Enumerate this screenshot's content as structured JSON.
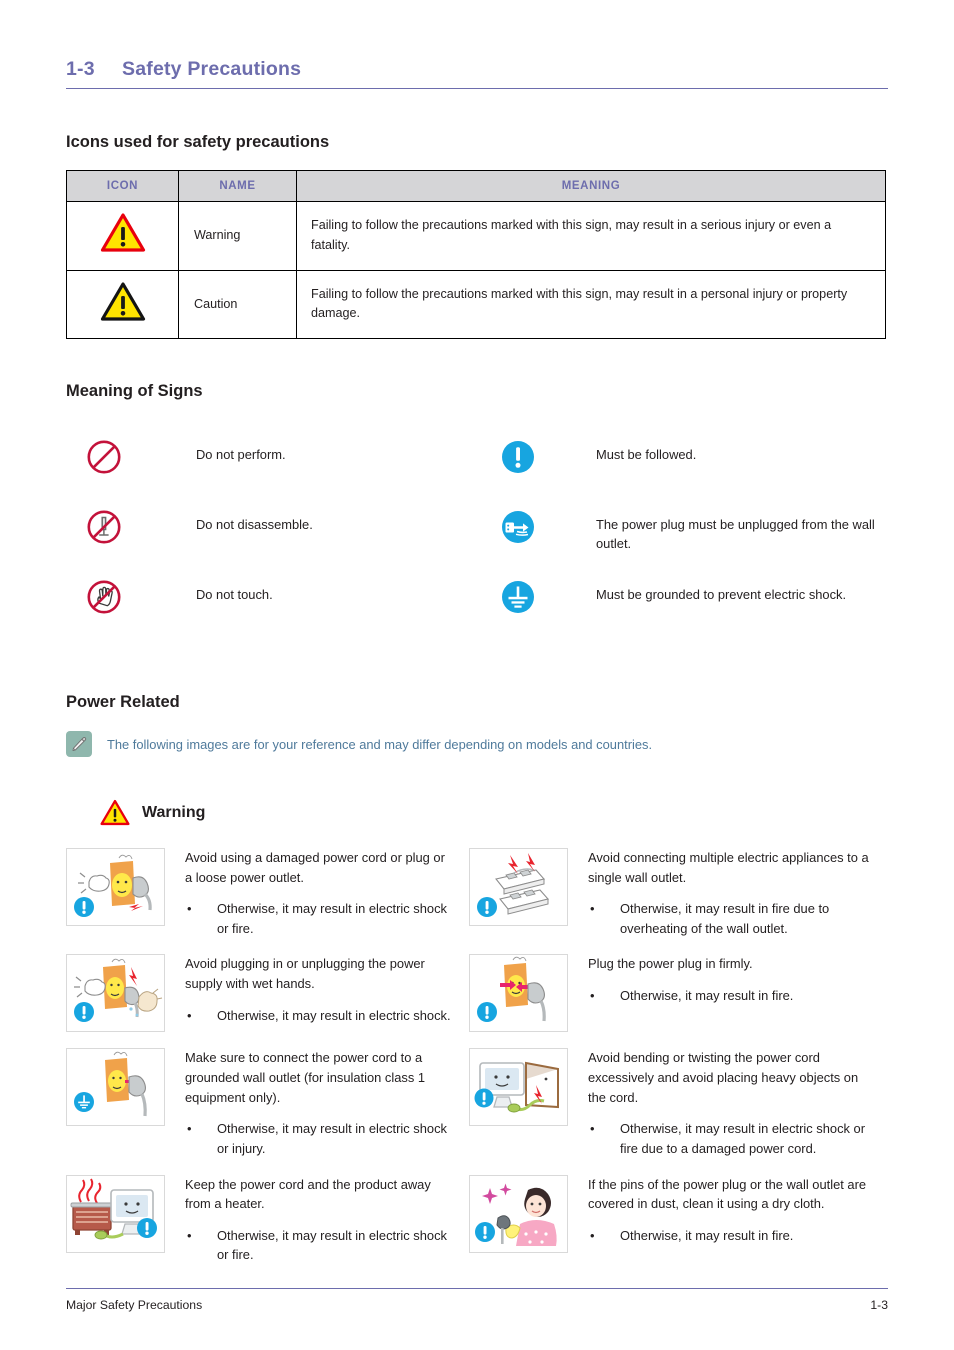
{
  "header": {
    "chapter_number": "1-3",
    "chapter_title": "Safety Precautions"
  },
  "sections": {
    "icons_heading": "Icons used for safety precautions",
    "signs_heading": "Meaning of Signs",
    "power_heading": "Power Related"
  },
  "icons_table": {
    "columns": [
      "ICON",
      "NAME",
      "MEANING"
    ],
    "rows": [
      {
        "icon": "warning-triangle-red-icon",
        "name": "Warning",
        "meaning": "Failing to follow the precautions marked with this sign, may result in a serious injury or even a fatality."
      },
      {
        "icon": "caution-triangle-black-icon",
        "name": "Caution",
        "meaning": "Failing to follow the precautions marked with this sign, may result in a personal injury or property damage."
      }
    ]
  },
  "meaning_of_signs": {
    "left": [
      {
        "icon": "prohibition-circle-icon",
        "text": "Do not perform."
      },
      {
        "icon": "no-disassemble-icon",
        "text": "Do not disassemble."
      },
      {
        "icon": "no-touch-hand-icon",
        "text": "Do not touch."
      }
    ],
    "right": [
      {
        "icon": "mandatory-exclamation-icon",
        "text": "Must be followed."
      },
      {
        "icon": "unplug-power-icon",
        "text": "The power plug must be unplugged from the wall outlet."
      },
      {
        "icon": "grounding-earth-icon",
        "text": "Must be grounded to prevent electric shock."
      }
    ]
  },
  "note": {
    "icon": "pencil-note-icon",
    "text": "The following images are for your reference and may differ depending on models and countries."
  },
  "warning_block": {
    "icon": "warning-triangle-red-icon",
    "label": "Warning",
    "items_left": [
      {
        "image": "damaged-power-cord-illustration",
        "title": "Avoid using a damaged power cord or plug or a loose power outlet.",
        "bullet_marker": "•",
        "bullet": "Otherwise, it may result in electric shock or fire."
      },
      {
        "image": "wet-hands-plug-illustration",
        "title": "Avoid plugging in or unplugging the power supply with wet hands.",
        "bullet_marker": "•",
        "bullet": "Otherwise, it may result in electric shock."
      },
      {
        "image": "grounded-outlet-illustration",
        "title": "Make sure to connect the power cord to a grounded wall outlet (for insulation class 1 equipment only).",
        "bullet_marker": "•",
        "bullet": "Otherwise, it may result in electric shock or injury."
      },
      {
        "image": "heater-away-from-product-illustration",
        "title": "Keep the power cord and the product away from a heater.",
        "bullet_marker": "•",
        "bullet": "Otherwise, it may result in electric shock or fire."
      }
    ],
    "items_right": [
      {
        "image": "multiple-appliances-outlet-illustration",
        "title": "Avoid connecting multiple electric appliances to a single wall outlet.",
        "bullet_marker": "•",
        "bullet": "Otherwise, it may result in fire due to overheating of the wall outlet."
      },
      {
        "image": "plug-in-firmly-illustration",
        "title": "Plug the power plug in firmly.",
        "bullet_marker": "•",
        "bullet": "Otherwise, it may result in fire."
      },
      {
        "image": "bending-cord-heavy-object-illustration",
        "title": "Avoid bending or twisting the power cord excessively and avoid placing heavy objects on the cord.",
        "bullet_marker": "•",
        "bullet": "Otherwise, it may result in electric shock or fire due to a damaged power cord."
      },
      {
        "image": "clean-dusty-plug-illustration",
        "title": "If the pins of the power plug or the wall outlet are covered in dust, clean it using a dry cloth.",
        "bullet_marker": "•",
        "bullet": "Otherwise, it may result in fire."
      }
    ]
  },
  "footer": {
    "left": "Major Safety Precautions",
    "right": "1-3"
  },
  "colors": {
    "heading_purple": "#6d6dad",
    "note_text_blue": "#4f7a9b",
    "note_icon_bg": "#8fb7ad",
    "table_header_bg": "#d5d5d7",
    "blue_icon": "#17a5e0",
    "prohibition_red": "#c3123a",
    "warning_yellow": "#ffe400",
    "warning_red_outline": "#e8000d"
  }
}
